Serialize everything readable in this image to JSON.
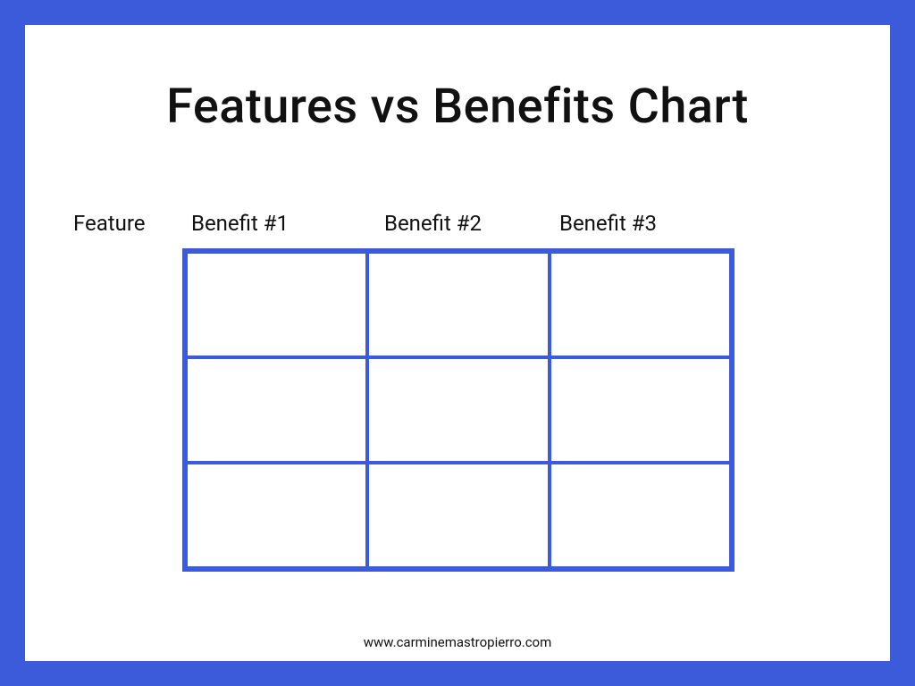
{
  "title": "Features vs Benefits Chart",
  "labels": {
    "feature": "Feature",
    "benefit1": "Benefit #1",
    "benefit2": "Benefit #2",
    "benefit3": "Benefit #3"
  },
  "footer": "www.carminemastropierro.com",
  "colors": {
    "accent": "#3b5bdb"
  },
  "chart_data": {
    "type": "table",
    "title": "Features vs Benefits Chart",
    "columns": [
      "Benefit #1",
      "Benefit #2",
      "Benefit #3"
    ],
    "row_label_header": "Feature",
    "rows": [
      {
        "feature": "",
        "benefits": [
          "",
          "",
          ""
        ]
      },
      {
        "feature": "",
        "benefits": [
          "",
          "",
          ""
        ]
      },
      {
        "feature": "",
        "benefits": [
          "",
          "",
          ""
        ]
      }
    ]
  }
}
